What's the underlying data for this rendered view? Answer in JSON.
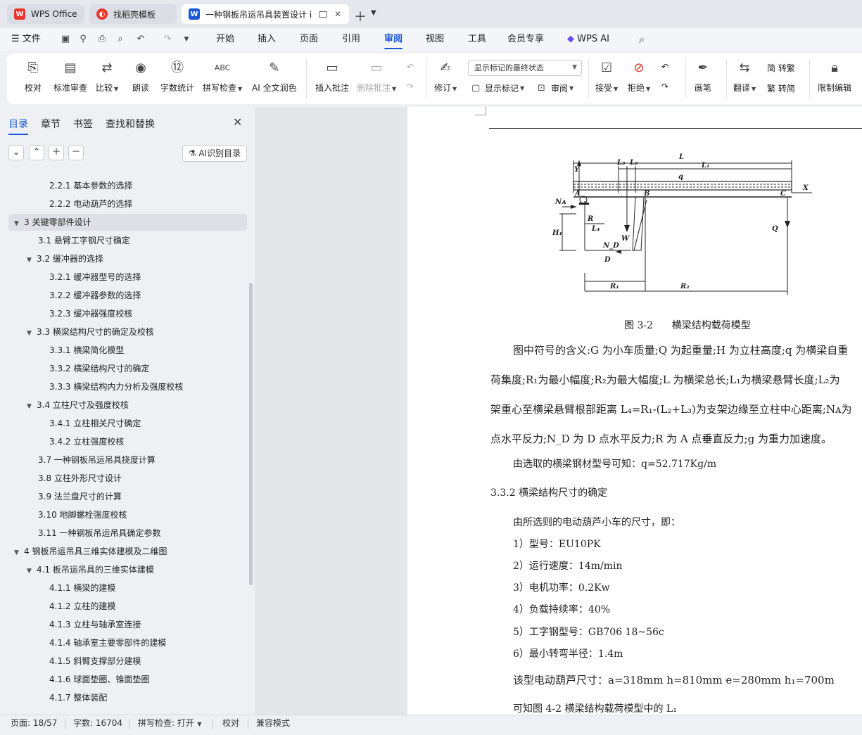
{
  "tabs": [
    {
      "label": "WPS Office",
      "icon": "wps-logo-icon",
      "color": "#e8362d"
    },
    {
      "label": "找稻壳模板",
      "icon": "docer-icon",
      "color": "#e8362d"
    },
    {
      "label": "一种钢板吊运吊具装置设计 i",
      "icon": "writer-doc-icon",
      "color": "#1a56d6"
    }
  ],
  "menu": {
    "file": "文件",
    "items": [
      "开始",
      "插入",
      "页面",
      "引用",
      "审阅",
      "视图",
      "工具",
      "会员专享"
    ],
    "active": "审阅",
    "wps_ai": "WPS AI"
  },
  "ribbon": {
    "proofread": "校对",
    "standard_review": "标准审查",
    "compare": "比较",
    "read_aloud": "朗读",
    "word_count": "字数统计",
    "spell_check": "拼写检查",
    "ai_polish": "AI 全文润色",
    "insert_comment": "插入批注",
    "delete_comment": "删除批注",
    "track_changes": "修订",
    "display_mode": "显示标记的最终状态",
    "show_markup": "显示标记",
    "review_pane": "审阅",
    "accept": "接受",
    "reject": "拒绝",
    "pen": "画笔",
    "translate": "翻译",
    "to_traditional": "简 转繁",
    "to_simplified": "繁 转简",
    "restrict_edit": "限制编辑"
  },
  "nav": {
    "tabs": [
      "目录",
      "章节",
      "书签",
      "查找和替换"
    ],
    "active_tab": "目录",
    "ai_toc": "AI识别目录",
    "toc": [
      {
        "label": "2.2.1  基本参数的选择",
        "level": 3,
        "tri": ""
      },
      {
        "label": "2.2.2  电动葫芦的选择",
        "level": 3,
        "tri": ""
      },
      {
        "label": "3   关键零部件设计",
        "level": 1,
        "tri": "▼",
        "selected": true
      },
      {
        "label": "3.1 悬臂工字钢尺寸确定",
        "level": 2,
        "tri": ""
      },
      {
        "label": "3.2 缓冲器的选择",
        "level": 2,
        "tri": "▼"
      },
      {
        "label": "3.2.1 缓冲器型号的选择",
        "level": 3,
        "tri": ""
      },
      {
        "label": "3.2.2 缓冲器参数的选择",
        "level": 3,
        "tri": ""
      },
      {
        "label": "3.2.3 缓冲器强度校核",
        "level": 3,
        "tri": ""
      },
      {
        "label": "3.3 横梁结构尺寸的确定及校核",
        "level": 2,
        "tri": "▼"
      },
      {
        "label": "3.3.1 横梁简化模型",
        "level": 3,
        "tri": ""
      },
      {
        "label": "3.3.2 横梁结构尺寸的确定",
        "level": 3,
        "tri": ""
      },
      {
        "label": "3.3.3 横梁结构内力分析及强度校核",
        "level": 3,
        "tri": ""
      },
      {
        "label": "3.4 立柱尺寸及强度校核",
        "level": 2,
        "tri": "▼"
      },
      {
        "label": "3.4.1 立柱相关尺寸确定",
        "level": 3,
        "tri": ""
      },
      {
        "label": "3.4.2 立柱强度校核",
        "level": 3,
        "tri": ""
      },
      {
        "label": "3.7 一种钢板吊运吊具挠度计算",
        "level": 2,
        "tri": ""
      },
      {
        "label": "3.8 立柱外形尺寸设计",
        "level": 2,
        "tri": ""
      },
      {
        "label": "3.9 法兰盘尺寸的计算",
        "level": 2,
        "tri": ""
      },
      {
        "label": "3.10 地脚螺栓强度校核",
        "level": 2,
        "tri": ""
      },
      {
        "label": "3.11  一种钢板吊运吊具确定参数",
        "level": 2,
        "tri": ""
      },
      {
        "label": "4   钢板吊运吊具三维实体建模及二维图",
        "level": 1,
        "tri": "▼"
      },
      {
        "label": "4.1   板吊运吊具的三维实体建模",
        "level": 2,
        "tri": "▼"
      },
      {
        "label": "4.1.1  横梁的建模",
        "level": 3,
        "tri": ""
      },
      {
        "label": "4.1.2  立柱的建模",
        "level": 3,
        "tri": ""
      },
      {
        "label": "4.1.3 立柱与轴承室连接",
        "level": 3,
        "tri": ""
      },
      {
        "label": "4.1.4 轴承室主要零部件的建模",
        "level": 3,
        "tri": ""
      },
      {
        "label": "4.1.5  斜臂支撑部分建模",
        "level": 3,
        "tri": ""
      },
      {
        "label": "4.1.6  球面垫圈、锥面垫圈",
        "level": 3,
        "tri": ""
      },
      {
        "label": "4.1.7  整体装配",
        "level": 3,
        "tri": ""
      }
    ]
  },
  "doc": {
    "figure_labels": {
      "L": "L",
      "Y": "Y",
      "L3": "L₃",
      "L2": "L₂",
      "q": "q",
      "L1": "L₁",
      "A": "A",
      "B": "B",
      "C": "C",
      "X": "X",
      "NA": "Nᴀ",
      "R": "R",
      "H1": "H₁",
      "L4": "L₄",
      "W": "W",
      "ND": "N_D",
      "D": "D",
      "Q": "Q",
      "R1": "R₁",
      "R2": "R₂"
    },
    "caption_num": "图 3-2",
    "caption_text": "横梁结构载荷模型",
    "p1": "图中符号的含义:G 为小车质量;Q 为起重量;H 为立柱高度;q 为横梁自重",
    "p2": "荷集度;R₁为最小幅度;R₂为最大幅度;L 为横梁总长;L₁为横梁悬臂长度;L₂为",
    "p3": "架重心至横梁悬臂根部距离 L₄=R₁-(L₂+L₃)为支架边缘至立柱中心距离;Nᴀ为",
    "p4": "点水平反力;N_D 为 D 点水平反力;R 为 A 点垂直反力;g 为重力加速度。",
    "p5": "由选取的横梁钢材型号可知：q=52.717Kg/m",
    "heading": "3.3.2 横梁结构尺寸的确定",
    "p6": "由所选则的电动葫芦小车的尺寸，即：",
    "list": [
      "1）型号：EU10PK",
      "2）运行速度：14m/min",
      "3）电机功率：0.2Kw",
      "4）负载持续率：40%",
      "5）工字钢型号：GB706     18~56c",
      "6）最小转弯半径：1.4m"
    ],
    "p7": "该型电动葫芦尺寸：a=318mm    h=810mm    e=280mm    h₁=700m",
    "p8": "可知图 4-2  横梁结构载荷模型中的 L₁"
  },
  "status": {
    "page": "页面: 18/57",
    "words": "字数: 16704",
    "spell": "拼写检查: 打开",
    "proof": "校对",
    "compat": "兼容模式"
  }
}
